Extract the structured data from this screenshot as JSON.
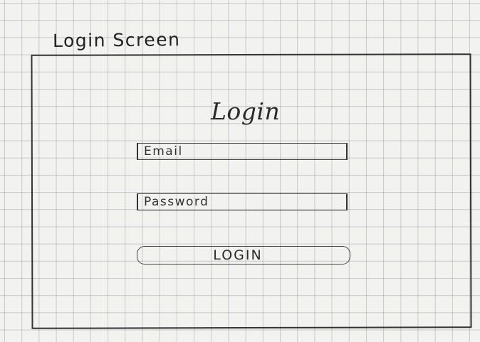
{
  "screen": {
    "title": "Login Screen"
  },
  "form": {
    "heading": "Login",
    "email": {
      "value": "",
      "placeholder": "Email"
    },
    "password": {
      "value": "",
      "placeholder": "Password"
    },
    "submit_label": "LOGIN"
  }
}
